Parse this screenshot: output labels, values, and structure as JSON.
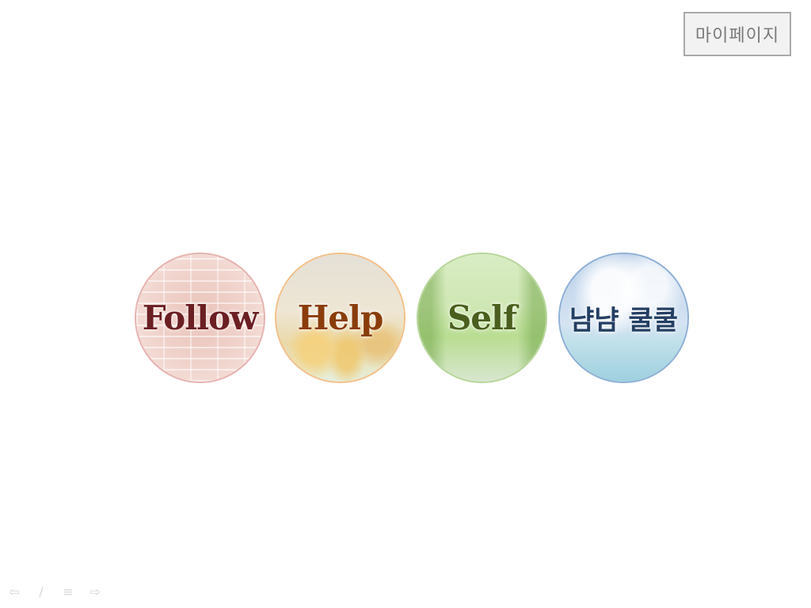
{
  "header": {
    "mypage_label": "마이페이지"
  },
  "circles": [
    {
      "label": "Follow",
      "color": "#6b1f23",
      "theme": "brick"
    },
    {
      "label": "Help",
      "color": "#8a3d0a",
      "theme": "tulips"
    },
    {
      "label": "Self",
      "color": "#4a5e1d",
      "theme": "tree-path"
    },
    {
      "label": "냠냠 쿨쿨",
      "color": "#243f63",
      "theme": "sky-sea"
    }
  ],
  "slide_nav": {
    "icons": [
      "back-arrow-icon",
      "pen-icon",
      "menu-icon",
      "forward-arrow-icon"
    ]
  }
}
